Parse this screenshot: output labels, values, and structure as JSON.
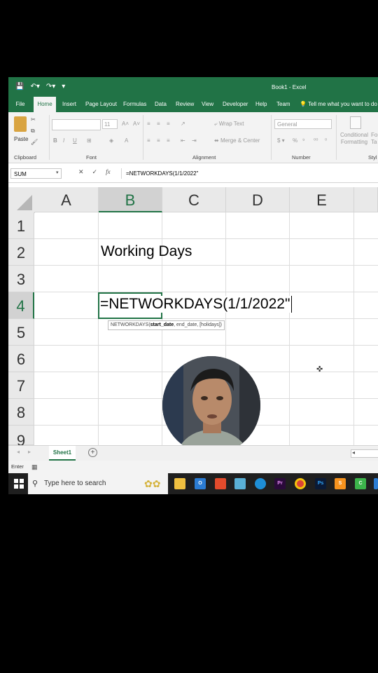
{
  "titlebar": {
    "title": "Book1 - Excel",
    "qat": [
      "save-icon",
      "undo-icon",
      "redo-icon"
    ]
  },
  "ribbon_tabs": [
    "File",
    "Home",
    "Insert",
    "Page Layout",
    "Formulas",
    "Data",
    "Review",
    "View",
    "Developer",
    "Help",
    "Team"
  ],
  "active_tab": "Home",
  "tell_me": "Tell me what you want to do",
  "ribbon": {
    "paste": "Paste",
    "clipboard": "Clipboard",
    "font": "Font",
    "font_size": "11",
    "alignment": "Alignment",
    "wrap_text": "Wrap Text",
    "merge_center": "Merge & Center",
    "number": "Number",
    "number_format": "General",
    "conditional_formatting": "Conditional Formatting",
    "format_as_table": "For Ta",
    "styles": "Styl"
  },
  "formula_bar": {
    "name_box": "SUM",
    "cancel": "✕",
    "enter": "✓",
    "fx": "fx",
    "formula": "=NETWORKDAYS(1/1/2022\""
  },
  "grid": {
    "columns": [
      "A",
      "B",
      "C",
      "D",
      "E"
    ],
    "selected_column": "B",
    "rows": [
      "1",
      "2",
      "3",
      "4",
      "5",
      "6",
      "7",
      "8",
      "9"
    ],
    "selected_row": "4",
    "cells": {
      "B2": "Working Days",
      "B4": "=NETWORKDAYS(1/1/2022\""
    },
    "tooltip": {
      "prefix": "NETWORKDAYS(",
      "bold_arg": "start_date",
      "rest": ", end_date, [holidays])"
    }
  },
  "sheets": [
    "Sheet1"
  ],
  "status": "Enter",
  "taskbar": {
    "search_placeholder": "Type here to search",
    "apps": [
      "file-explorer",
      "outlook",
      "office",
      "notepad",
      "edge",
      "premiere-pro",
      "chrome",
      "photoshop",
      "sublime",
      "camtasia"
    ]
  },
  "colors": {
    "excel_green": "#217346",
    "taskbar": "#1f1f1f"
  }
}
